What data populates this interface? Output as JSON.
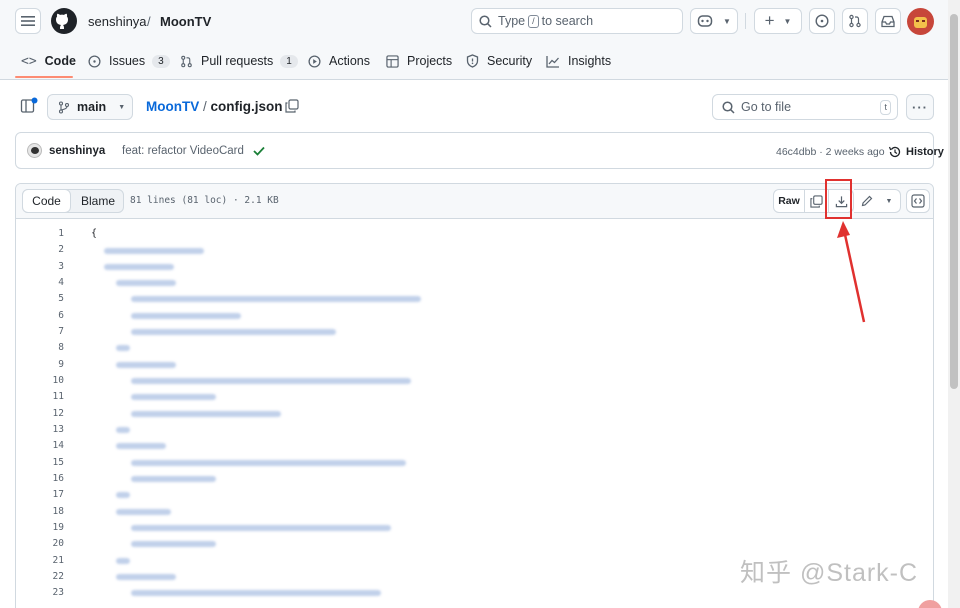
{
  "header": {
    "owner": "senshinya",
    "separator": "/",
    "repo": "MoonTV",
    "search": {
      "prefix": "Type",
      "key": "/",
      "suffix": "to search"
    }
  },
  "tabs": [
    {
      "label": "Code",
      "icon": "code-icon"
    },
    {
      "label": "Issues",
      "count": "3",
      "icon": "issue-icon"
    },
    {
      "label": "Pull requests",
      "count": "1",
      "icon": "pull-request-icon"
    },
    {
      "label": "Actions",
      "icon": "play-icon"
    },
    {
      "label": "Projects",
      "icon": "table-icon"
    },
    {
      "label": "Security",
      "icon": "shield-icon"
    },
    {
      "label": "Insights",
      "icon": "graph-icon"
    }
  ],
  "file_nav": {
    "branch": "main",
    "repo": "MoonTV",
    "separator": "/",
    "file": "config.json",
    "go_to_file": "Go to file",
    "go_to_file_key": "t"
  },
  "commit": {
    "author": "senshinya",
    "message": "feat: refactor VideoCard",
    "hash": "46c4dbb",
    "time": "2 weeks ago",
    "history": "History",
    "status_color": "#1a7f37"
  },
  "code_view": {
    "code_tab": "Code",
    "blame_tab": "Blame",
    "file_info": "81 lines (81 loc) · 2.1 KB",
    "raw": "Raw",
    "first_line": "{",
    "line_numbers": [
      "1",
      "2",
      "3",
      "4",
      "5",
      "6",
      "7",
      "8",
      "9",
      "10",
      "11",
      "12",
      "13",
      "14",
      "15",
      "16",
      "17",
      "18",
      "19",
      "20",
      "21",
      "22",
      "23"
    ]
  },
  "watermark": "知乎 @Stark-C",
  "colors": {
    "accent": "#0969da",
    "tab_underline": "#fd8c73",
    "annotation": "#e0312f"
  }
}
